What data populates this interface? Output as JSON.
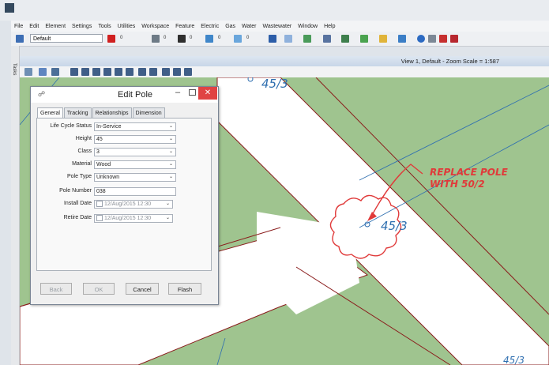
{
  "menu": [
    "File",
    "Edit",
    "Element",
    "Settings",
    "Tools",
    "Utilities",
    "Workspace",
    "Feature",
    "Electric",
    "Gas",
    "Water",
    "Wastewater",
    "Window",
    "Help"
  ],
  "toolbar": {
    "workspace_combo": "Default",
    "color_value": "0",
    "weight_value": "0",
    "style_value": "0",
    "level_value": "0",
    "extra_value": "0"
  },
  "tool_strip_label": "Tasks",
  "view": {
    "title": "View 1, Default - Zoom Scale = 1:587"
  },
  "map": {
    "pole_label_top": "45/3",
    "pole_label_center": "45/3",
    "pole_label_corner": "45/3",
    "markup_line1": "REPLACE POLE",
    "markup_line2": "WITH 50/2",
    "colors": {
      "ground": "#9fc48f",
      "road": "#ffffff",
      "parcel_line": "#8a1c1c",
      "markup": "#e03a3a",
      "pole": "#2f6fb0"
    }
  },
  "dialog": {
    "title": "Edit Pole",
    "tabs": [
      "General",
      "Tracking",
      "Relationships",
      "Dimension"
    ],
    "fields": [
      {
        "label": "Life Cycle Status",
        "value": "In-Service",
        "dropdown": true
      },
      {
        "label": "Height",
        "value": "45",
        "dropdown": true
      },
      {
        "label": "Class",
        "value": "3",
        "dropdown": true
      },
      {
        "label": "Material",
        "value": "Wood",
        "dropdown": true
      },
      {
        "label": "Pole Type",
        "value": "Unknown",
        "dropdown": true
      },
      {
        "label": "Pole Number",
        "value": "038",
        "dropdown": false
      },
      {
        "label": "Install Date",
        "value": "12/Aug/2015 12:30",
        "dropdown": true,
        "checkbox": true
      },
      {
        "label": "Retire Date",
        "value": "12/Aug/2015 12:30",
        "dropdown": true,
        "checkbox": true
      }
    ],
    "buttons": {
      "back": "Back",
      "ok": "OK",
      "cancel": "Cancel",
      "flash": "Flash"
    }
  }
}
